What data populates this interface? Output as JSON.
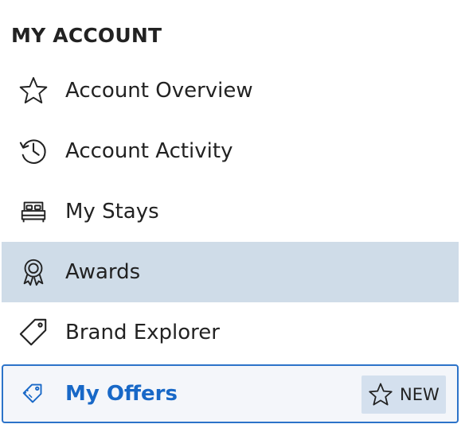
{
  "heading": "MY ACCOUNT",
  "menu": {
    "items": [
      {
        "label": "Account Overview",
        "icon": "star-icon"
      },
      {
        "label": "Account Activity",
        "icon": "history-clock-icon"
      },
      {
        "label": "My Stays",
        "icon": "bed-icon"
      },
      {
        "label": "Awards",
        "icon": "award-ribbon-icon"
      },
      {
        "label": "Brand Explorer",
        "icon": "tag-icon"
      },
      {
        "label": "My Offers",
        "icon": "offers-tag-icon",
        "badge": "NEW"
      }
    ]
  },
  "colors": {
    "active_background": "#cfdce8",
    "current_border": "#2c73c9",
    "current_text": "#1868c7",
    "badge_background": "#d4e0ee"
  }
}
